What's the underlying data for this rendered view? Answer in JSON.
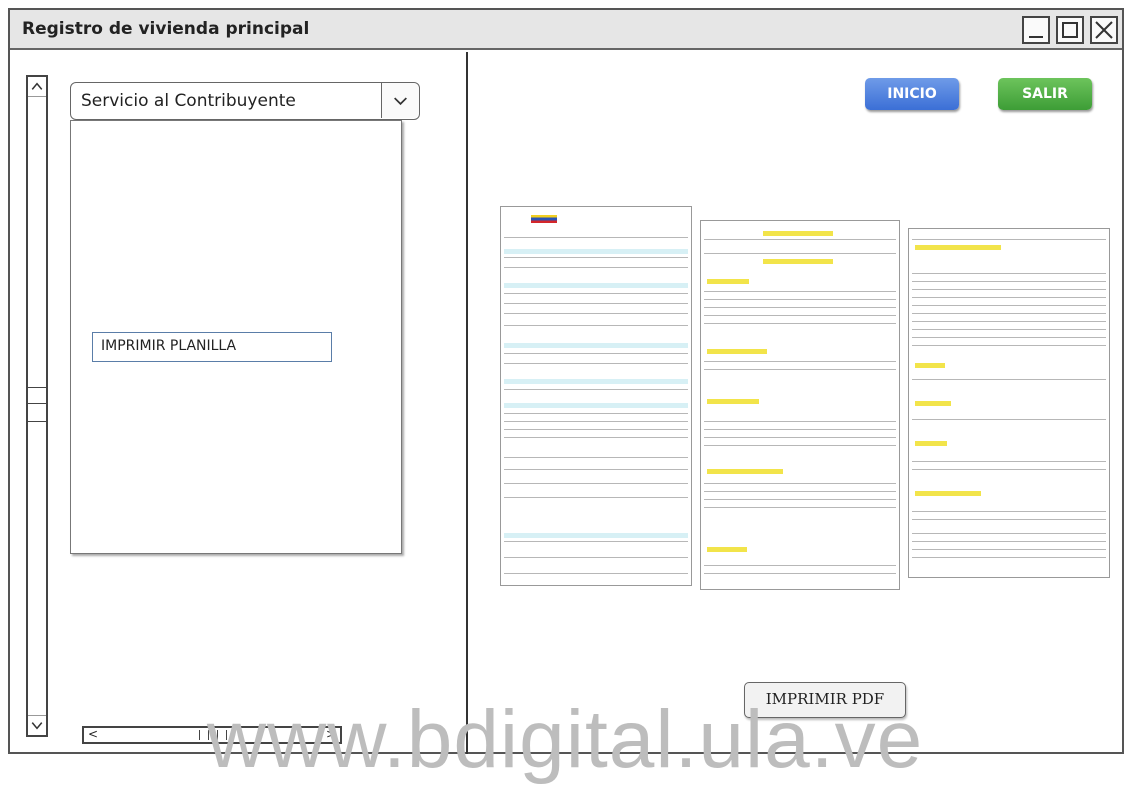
{
  "window": {
    "title": "Registro de vivienda principal",
    "controls": [
      "minimize-icon",
      "maximize-icon",
      "close-icon"
    ]
  },
  "sidebar": {
    "combo_value": "Servicio al Contribuyente",
    "list_items": [
      {
        "label": "IMPRIMIR PLANILLA"
      }
    ]
  },
  "header_buttons": {
    "inicio": "INICIO",
    "salir": "SALIR"
  },
  "main": {
    "print_pdf": "IMPRIMIR PDF"
  },
  "watermark": "www.bdigital.ula.ve",
  "colors": {
    "inicio": "#3b6fd6",
    "salir": "#3d9d36",
    "form_highlight": "#f2e44a"
  }
}
